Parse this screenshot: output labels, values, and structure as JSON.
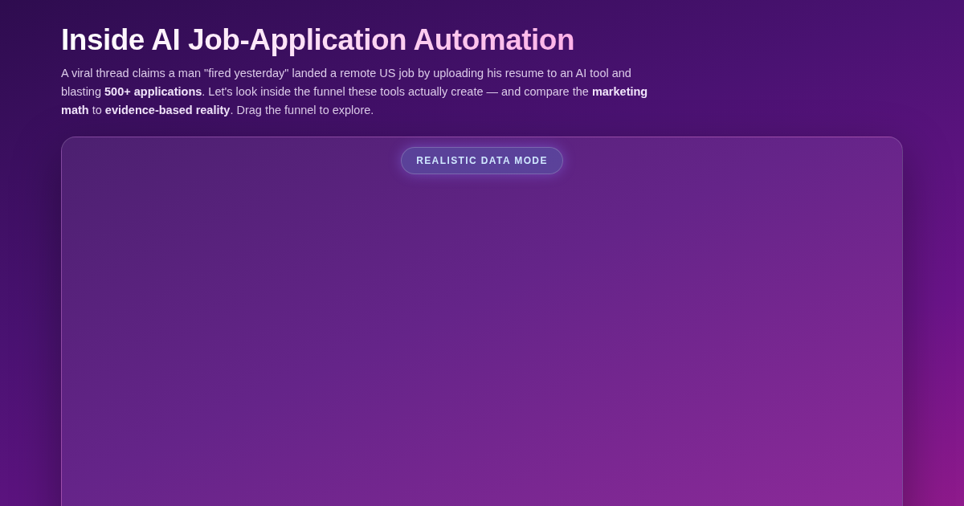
{
  "header": {
    "title": "Inside AI Job-Application Automation",
    "intro": "A viral thread claims a man \"fired yesterday\" landed a remote US job by uploading his resume to an AI tool and blasting **500+ applications**. Let's look inside the funnel these tools actually create — and compare the **marketing math** to **evidence-based reality**. Drag the funnel to explore."
  },
  "panel": {
    "mode_badge": "REALISTIC DATA MODE"
  }
}
